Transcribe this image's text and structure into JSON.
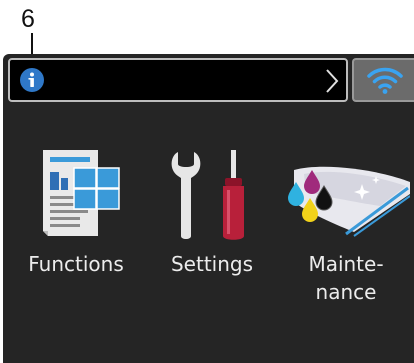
{
  "callout": {
    "number": "6"
  },
  "status_bar": {
    "info_icon": "info-icon",
    "chevron_icon": "chevron-right-icon",
    "text": ""
  },
  "wifi": {
    "icon": "wifi-icon",
    "accent": "#3aa3f0"
  },
  "apps": [
    {
      "icon": "functions-icon",
      "label": "Functions"
    },
    {
      "icon": "settings-icon",
      "label": "Settings"
    },
    {
      "icon": "maintenance-icon",
      "label_line1": "Mainte-",
      "label_line2": "nance"
    }
  ],
  "colors": {
    "screen_bg": "#252525",
    "status_bg": "#000000",
    "info_blue": "#2f78c8",
    "tile_blue": "#3a9ad9",
    "screwdriver_red": "#b8203a"
  }
}
